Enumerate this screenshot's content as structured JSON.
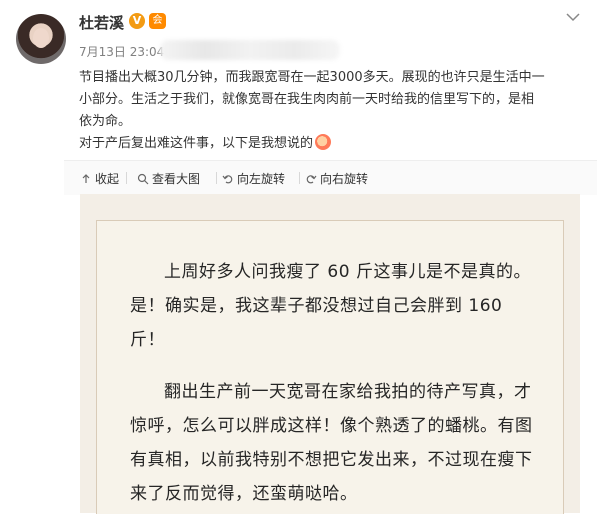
{
  "post": {
    "author_name": "杜若溪",
    "verified_badge": "V",
    "member_badge": "会",
    "meta_time": "7月13日 23:04",
    "text_lines": [
      "节目播出大概30几分钟，而我跟宽哥在一起3000多天。展现的也许只是生活中一",
      "小部分。生活之于我们，就像宽哥在我生肉肉前一天时给我的信里写下的，是相",
      "依为命。",
      "对于产后复出难这件事，以下是我想说的"
    ]
  },
  "toolbar": {
    "collapse": "收起",
    "view_large": "查看大图",
    "rotate_left": "向左旋转",
    "rotate_right": "向右旋转"
  },
  "image_text": {
    "paragraph_1": "上周好多人问我瘦了 60 斤这事儿是不是真的。是！确实是，我这辈子都没想过自己会胖到 160 斤！",
    "paragraph_2": "翻出生产前一天宽哥在家给我拍的待产写真，才惊呼，怎么可以胖成这样！像个熟透了的蟠桃。有图有真相，以前我特别不想把它发出来，不过现在瘦下来了反而觉得，还蛮萌哒哈。"
  },
  "colors": {
    "verified": "#f39b13",
    "member": "#ff8a00",
    "paper": "#f7f3ea"
  },
  "icons": {
    "collapse": "arrow-up-icon",
    "view_large": "search-icon",
    "rotate_left": "rotate-left-icon",
    "rotate_right": "rotate-right-icon",
    "more": "chevron-down-icon"
  }
}
